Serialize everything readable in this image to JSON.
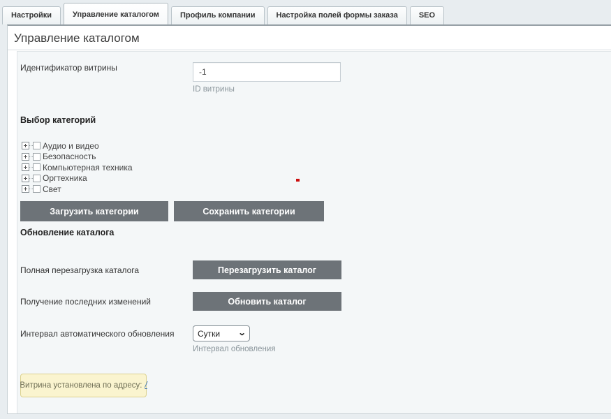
{
  "tabs": [
    {
      "label": "Настройки",
      "active": false
    },
    {
      "label": "Управление каталогом",
      "active": true
    },
    {
      "label": "Профиль компании",
      "active": false
    },
    {
      "label": "Настройка полей формы заказа",
      "active": false
    },
    {
      "label": "SEO",
      "active": false
    }
  ],
  "page": {
    "title": "Управление каталогом"
  },
  "storefront_id": {
    "label": "Идентификатор витрины",
    "value": "-1",
    "helper": "ID витрины"
  },
  "categories": {
    "heading": "Выбор категорий",
    "items": [
      "Аудио и видео",
      "Безопасность",
      "Компьютерная техника",
      "Оргтехника",
      "Свет"
    ],
    "load_button": "Загрузить категории",
    "save_button": "Сохранить категории"
  },
  "update": {
    "heading": "Обновление каталога",
    "reload_row": {
      "label": "Полная перезагрузка каталога",
      "button": "Перезагрузить каталог"
    },
    "refresh_row": {
      "label": "Получение последних изменений",
      "button": "Обновить каталог"
    },
    "interval": {
      "label": "Интервал автоматического обновления",
      "value": "Сутки",
      "helper": "Интервал обновления"
    }
  },
  "notice": {
    "text": "Витрина установлена по адресу:",
    "link": "/"
  },
  "colors": {
    "button_bg": "#6d7378",
    "page_bg": "#e8edf0",
    "form_bg": "#f4f7f8",
    "notice_bg": "#faf4cf",
    "notice_border": "#dcd28f",
    "link": "#3a70b0",
    "helper_text": "#8a959b"
  }
}
